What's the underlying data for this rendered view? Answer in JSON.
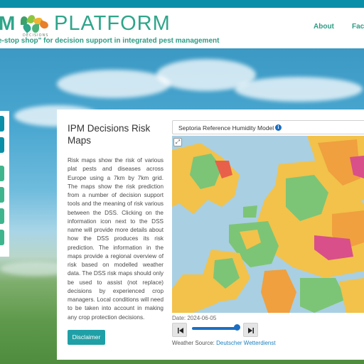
{
  "header": {
    "logo_left": "M",
    "logo_right": "PLATFORM",
    "logo_sub": "DECISIONS",
    "tagline": "e-stop shop\" for decision support in integrated pest management",
    "nav": [
      {
        "label": "About"
      },
      {
        "label": "Facts"
      }
    ]
  },
  "colors": {
    "brand_green": "#2fa58a",
    "top_bar": "#0a8fa8",
    "button_teal": "#1fa0a6",
    "link_blue": "#1a7fc1"
  },
  "main": {
    "title": "IPM Decisions Risk Maps",
    "description": "Risk maps show the risk of various plat pests and diseases across Europe using a 7km by 7km grid. The maps show the risk prediction from a number of decision support tools and the meaning of risk various between the DSS. Clicking on the information icon next to the DSS name will provide more details about how the DSS produces its risk prediction. The information in the maps provide a regional overview of risk based on modelled weather data. The DSS risk maps should only be used to assist (not replace) decisions by experienced crop managers. Local conditions will need to be taken into account in making any crop protection decisions.",
    "disclaimer_label": "Disclaimer"
  },
  "map_panel": {
    "model_name": "Septoria Reference Humidity Model",
    "info_icon": "info-icon",
    "expand_icon": "expand-icon",
    "date_text": "Date: 2024-06-05",
    "weather_source_label": "Weather Source:",
    "weather_source_link": "Deutscher Wetterdienst",
    "controls": {
      "prev_icon": "skip-back-icon",
      "next_icon": "skip-forward-icon",
      "slider_value_fraction": 1.0
    }
  }
}
